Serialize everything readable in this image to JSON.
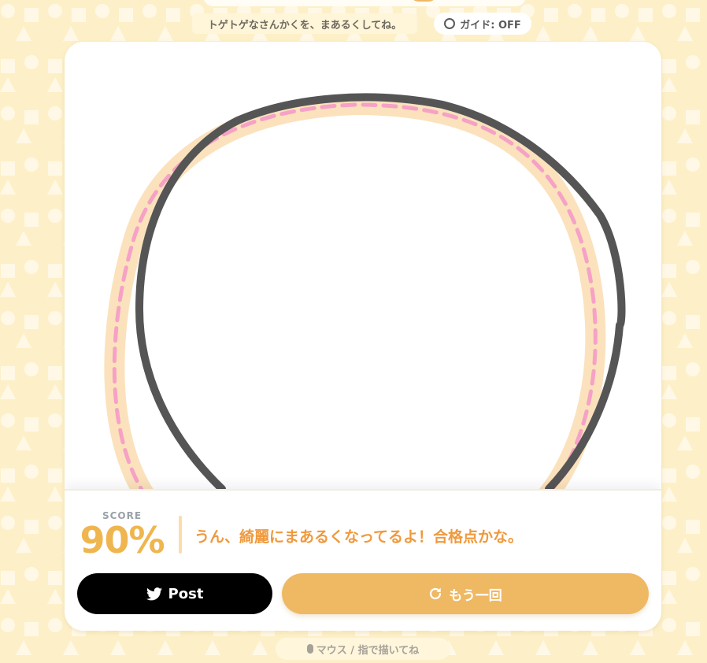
{
  "header": {
    "instruction": "トゲトゲなさんかくを、まあるくしてね。",
    "guide_toggle_label": "ガイド: OFF"
  },
  "result": {
    "score_label": "SCORE",
    "score_value": "90%",
    "message": "うん、綺麗にまあるくなってるよ！合格点かな。",
    "post_label": "Post",
    "retry_label": "もう一回"
  },
  "footer": {
    "hint": "マウス / 指で描いてね"
  },
  "icons": {
    "guide": "circle-outline-icon",
    "post": "twitter-bird-icon",
    "retry": "refresh-icon",
    "mouse": "mouse-icon",
    "finger": "finger-icon"
  },
  "colors": {
    "background": "#fdf0c8",
    "accent": "#efb863",
    "score": "#efb64f",
    "message": "#f0993c",
    "stroke": "#555555",
    "target_band": "#fbe2bd",
    "target_dash": "#f6a1c6"
  }
}
